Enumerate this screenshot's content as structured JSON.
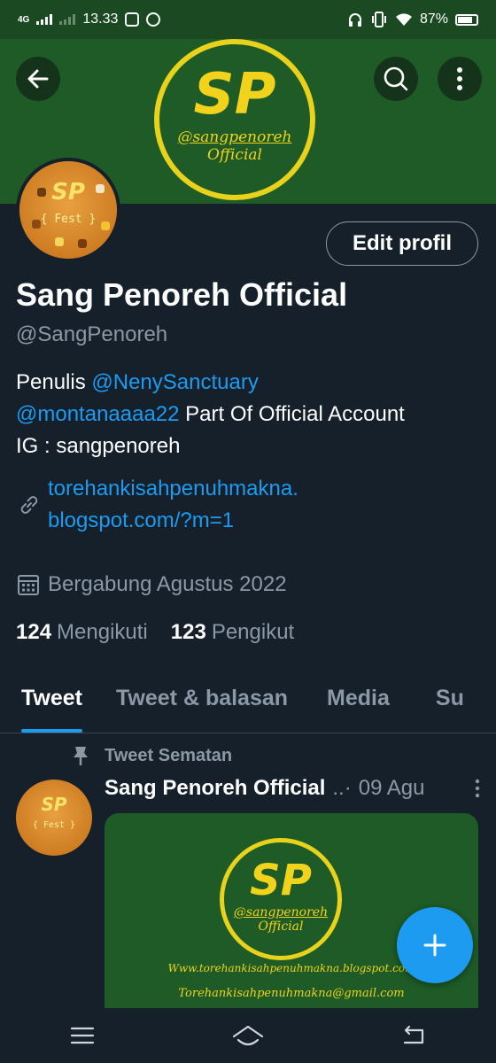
{
  "status_bar": {
    "network": "4G",
    "time": "13.33",
    "battery": "87%"
  },
  "profile": {
    "banner_logo": {
      "monogram": "SP",
      "handle": "@sangpenoreh",
      "subtitle": "Official"
    },
    "avatar_logo": {
      "monogram": "SP",
      "tag": "{ Fest }"
    },
    "edit_button": "Edit profil",
    "name": "Sang Penoreh Official",
    "handle": "@SangPenoreh",
    "bio": {
      "prefix": "Penulis ",
      "mention1": "@NenySanctuary",
      "mention2": "@montanaaaa22",
      "line2_rest": " Part Of Official Account",
      "line3": "IG : sangpenoreh"
    },
    "website": "torehankisahpenuhmakna.blogspot.com/?m=1",
    "joined": "Bergabung Agustus 2022",
    "following_count": "124",
    "following_label": "Mengikuti",
    "followers_count": "123",
    "followers_label": "Pengikut"
  },
  "tabs": [
    {
      "label": "Tweet",
      "active": true
    },
    {
      "label": "Tweet & balasan",
      "active": false
    },
    {
      "label": "Media",
      "active": false
    },
    {
      "label": "Su",
      "active": false
    }
  ],
  "pinned_tweet": {
    "pinned_label": "Tweet Sematan",
    "author": "Sang Penoreh Official",
    "ellipsis": "..·",
    "date": "09 Agu",
    "media": {
      "monogram": "SP",
      "handle": "@sangpenoreh",
      "subtitle": "Official",
      "url": "Www.torehankisahpenuhmakna.blogspot.com",
      "email": "Torehankisahpenuhmakna@gmail.com"
    }
  },
  "colors": {
    "background": "#15202b",
    "accent": "#1d9bf0",
    "banner_green": "#1e5b27",
    "logo_yellow": "#f0d31a",
    "muted": "#8b98a5"
  }
}
